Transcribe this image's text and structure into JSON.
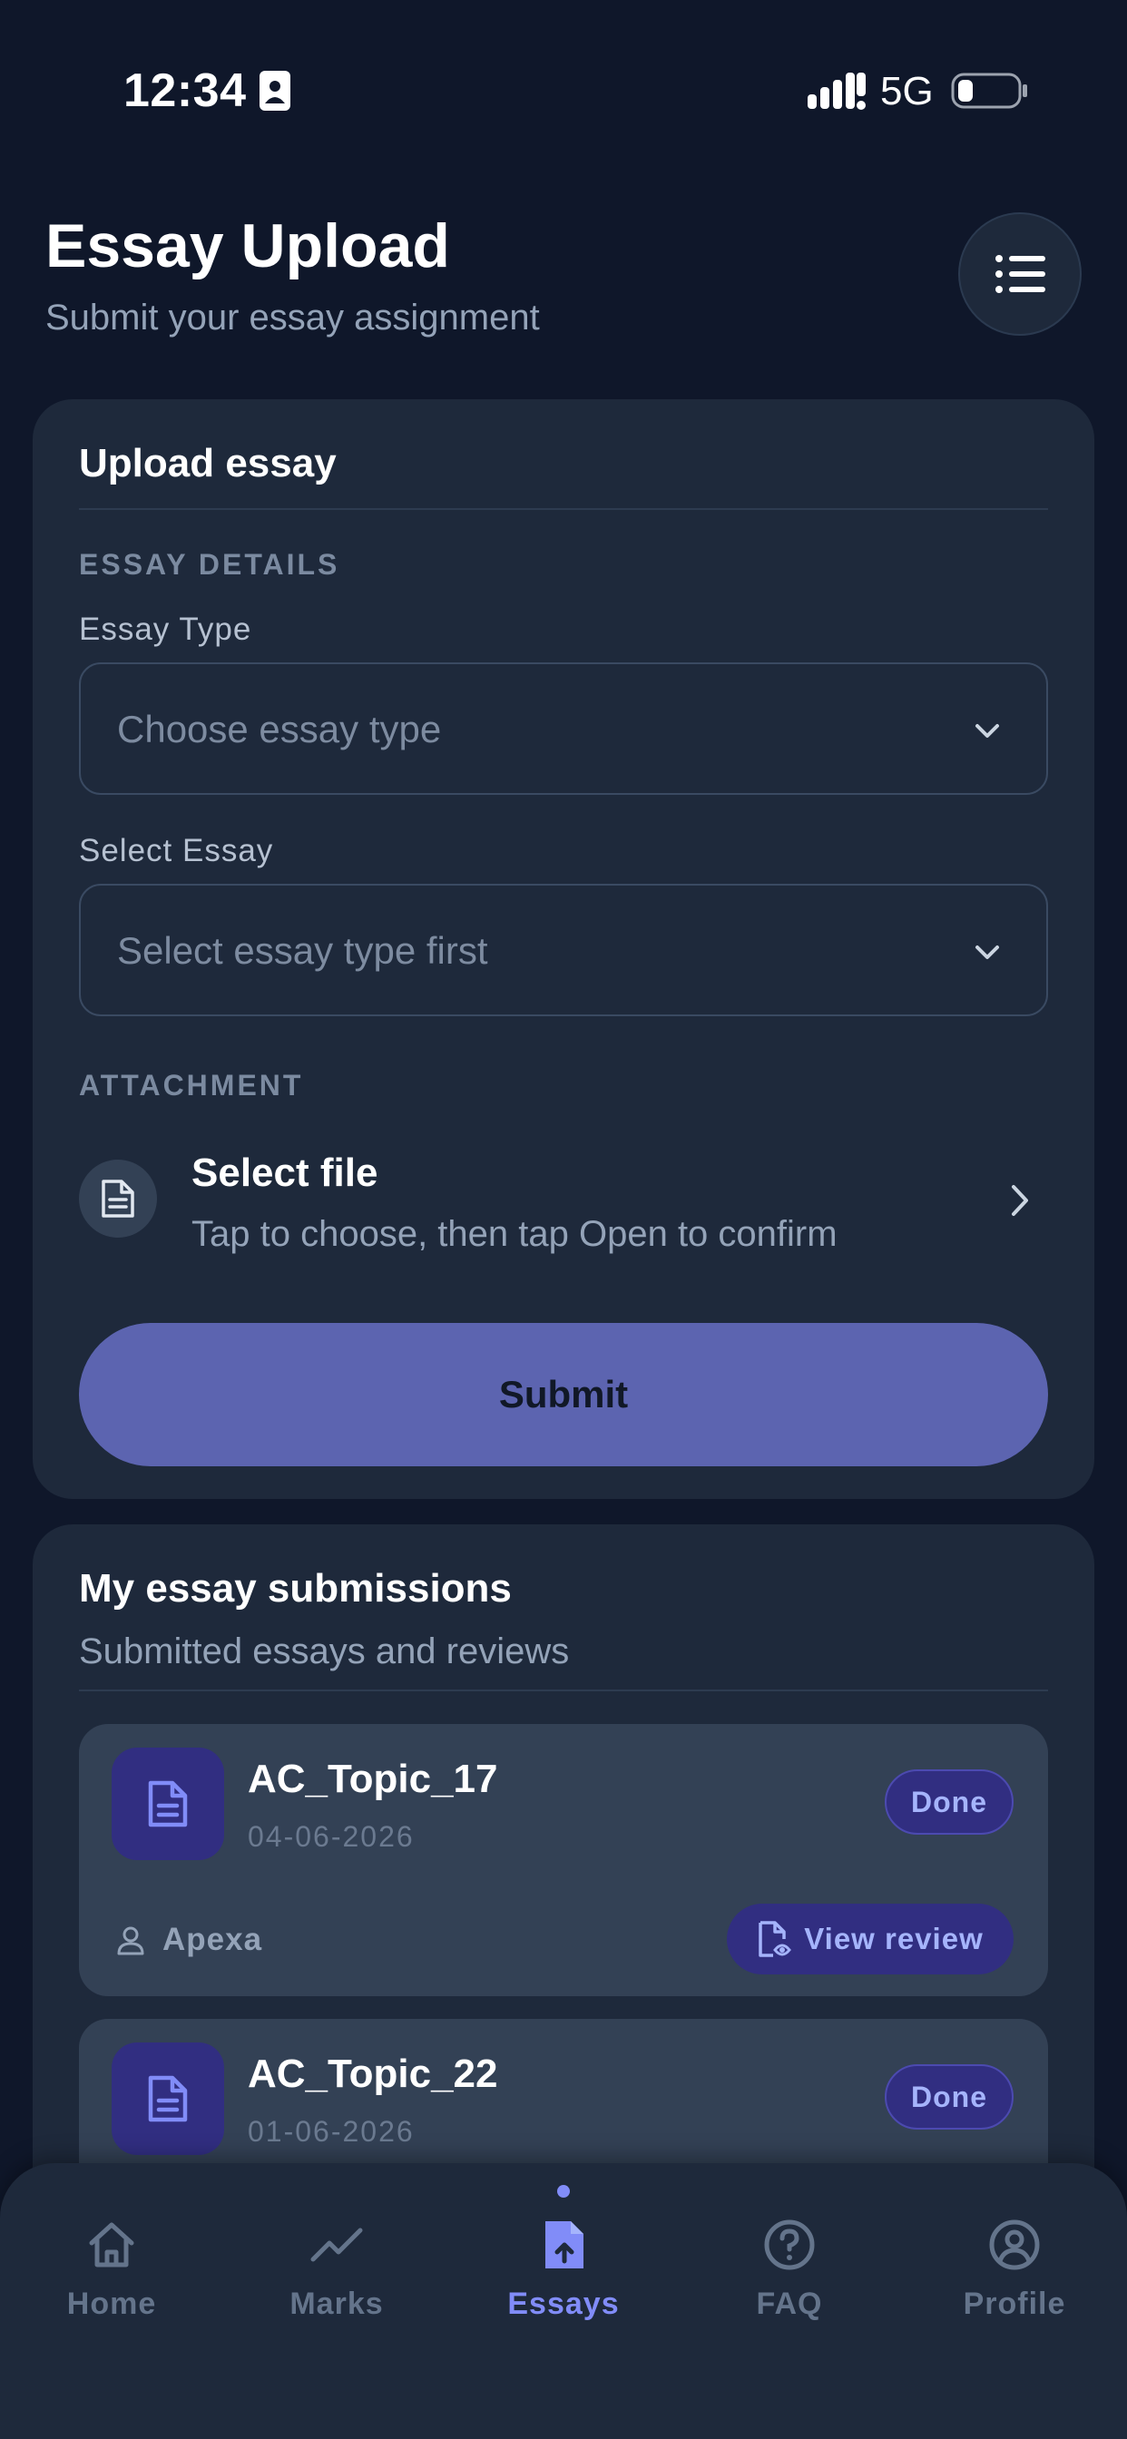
{
  "status_bar": {
    "time": "12:34",
    "network": "5G"
  },
  "header": {
    "title": "Essay Upload",
    "subtitle": "Submit your essay assignment",
    "menu_icon": "list-icon"
  },
  "upload_card": {
    "title": "Upload essay",
    "section_details": "ESSAY DETAILS",
    "essay_type_label": "Essay Type",
    "essay_type_placeholder": "Choose essay type",
    "select_essay_label": "Select Essay",
    "select_essay_placeholder": "Select essay type first",
    "section_attachment": "ATTACHMENT",
    "file_title": "Select file",
    "file_hint": "Tap to choose, then tap Open to confirm",
    "submit_label": "Submit"
  },
  "submissions": {
    "title": "My essay submissions",
    "subtitle": "Submitted essays and reviews",
    "items": [
      {
        "name": "AC_Topic_17",
        "date": "04-06-2026",
        "status": "Done",
        "author": "Apexa",
        "action": "View review"
      },
      {
        "name": "AC_Topic_22",
        "date": "01-06-2026",
        "status": "Done"
      }
    ]
  },
  "nav": {
    "items": [
      {
        "label": "Home",
        "icon": "home-icon"
      },
      {
        "label": "Marks",
        "icon": "trend-icon"
      },
      {
        "label": "Essays",
        "icon": "file-upload-icon",
        "active": true
      },
      {
        "label": "FAQ",
        "icon": "help-icon"
      },
      {
        "label": "Profile",
        "icon": "user-circle-icon"
      }
    ]
  },
  "colors": {
    "background": "#0f172a",
    "card": "#1e293b",
    "accent": "#818cf8",
    "submit_button": "#5c64b0"
  }
}
